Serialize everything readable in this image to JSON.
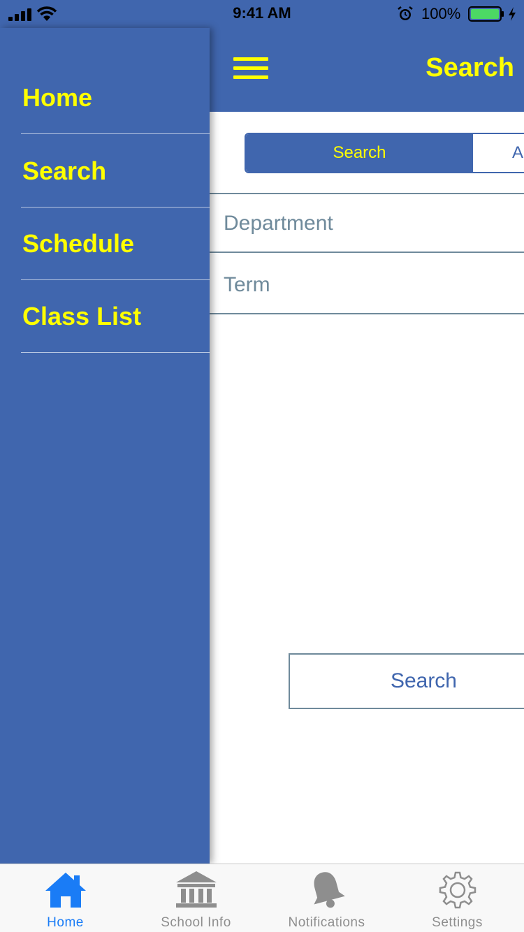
{
  "status_bar": {
    "time": "9:41 AM",
    "battery_percent": "100%"
  },
  "header": {
    "title": "Search",
    "menu_icon": "hamburger-menu-icon"
  },
  "segmented_control": {
    "segments": [
      {
        "label": "Search",
        "selected": true
      },
      {
        "label": "A",
        "selected": false
      }
    ]
  },
  "form": {
    "department_placeholder": "Department",
    "term_placeholder": "Term",
    "search_button_label": "Search"
  },
  "drawer": {
    "items": [
      {
        "label": "Home"
      },
      {
        "label": "Search"
      },
      {
        "label": "Schedule"
      },
      {
        "label": "Class List"
      }
    ]
  },
  "tab_bar": {
    "tabs": [
      {
        "label": "Home",
        "icon": "home-icon",
        "active": true
      },
      {
        "label": "School Info",
        "icon": "school-building-icon",
        "active": false
      },
      {
        "label": "Notifications",
        "icon": "bell-icon",
        "active": false
      },
      {
        "label": "Settings",
        "icon": "gear-icon",
        "active": false
      }
    ]
  },
  "colors": {
    "primary": "#4066ae",
    "accent_text": "#ffff00",
    "field_border": "#6f8a9b",
    "tab_active": "#1a7cf6",
    "tab_inactive": "#8e8e8e"
  }
}
